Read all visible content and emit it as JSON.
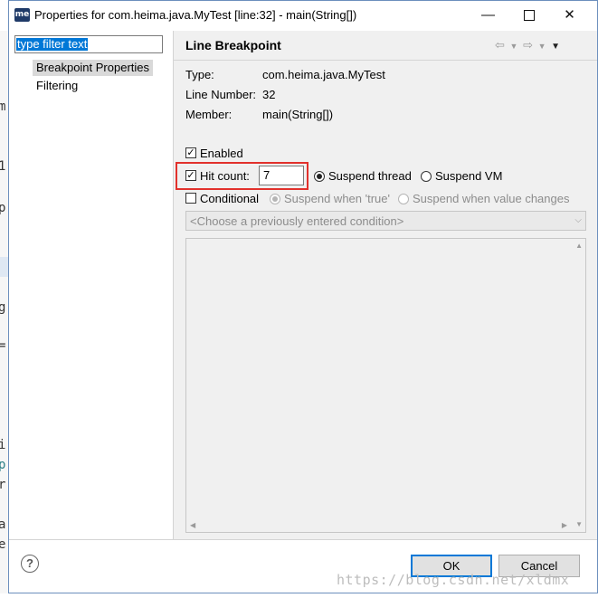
{
  "window": {
    "app_icon": "me",
    "title": "Properties for com.heima.java.MyTest [line:32] - main(String[])",
    "minimize_icon": "minimize-icon",
    "maximize_icon": "maximize-icon",
    "close_icon": "close-icon"
  },
  "left": {
    "filter_value": "type filter text",
    "items": [
      {
        "label": "Breakpoint Properties",
        "selected": true
      },
      {
        "label": "Filtering",
        "selected": false
      }
    ]
  },
  "right": {
    "title": "Line Breakpoint",
    "fields": [
      {
        "label": "Type:",
        "value": "com.heima.java.MyTest"
      },
      {
        "label": "Line Number:",
        "value": "32"
      },
      {
        "label": "Member:",
        "value": "main(String[])"
      }
    ],
    "enabled": {
      "label": "Enabled",
      "checked": true
    },
    "hit_count": {
      "label": "Hit count:",
      "checked": true,
      "value": "7"
    },
    "suspend_thread": {
      "label": "Suspend thread",
      "selected": true
    },
    "suspend_vm": {
      "label": "Suspend VM",
      "selected": false
    },
    "conditional": {
      "label": "Conditional",
      "checked": false
    },
    "suspend_true": {
      "label": "Suspend when 'true'",
      "selected": true
    },
    "suspend_change": {
      "label": "Suspend when value changes",
      "selected": false
    },
    "condition_combo": "<Choose a previously entered condition>"
  },
  "buttons": {
    "ok": "OK",
    "cancel": "Cancel"
  },
  "watermark": "https://blog.csdn.net/xldmx",
  "colors": {
    "accent": "#0078d7",
    "highlight_box": "#e2312c",
    "pane_bg": "#f0f0f0"
  }
}
